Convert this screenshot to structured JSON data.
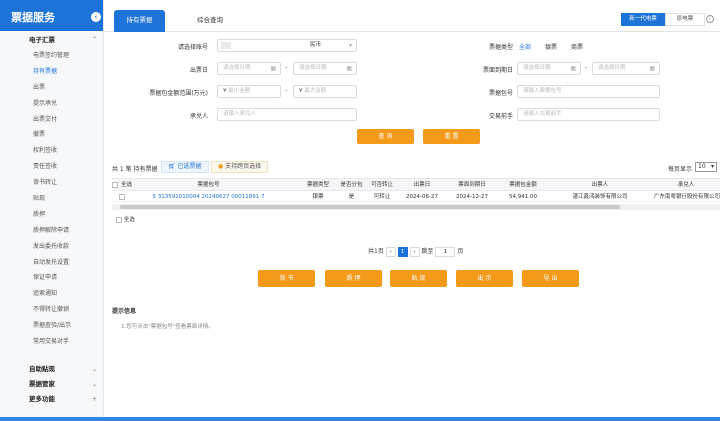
{
  "sidebar": {
    "title": "票据服务",
    "collapse_icon": "chevron-left",
    "group": "电子汇票",
    "items": [
      "电票签约管理",
      "持有票据",
      "出票",
      "提示承兑",
      "出票交付",
      "撤票",
      "权利签收",
      "责任签收",
      "背书转让",
      "贴现",
      "质押",
      "质押解除申请",
      "发出委托收款",
      "自动发托设置",
      "保证申请",
      "追索通知",
      "不得转让撤销",
      "票据查验/出示",
      "常用交易对手"
    ],
    "active_index": 1,
    "bottom_groups": [
      {
        "label": "自助贴现",
        "caret": "⌄"
      },
      {
        "label": "票据管家",
        "caret": "⌄"
      },
      {
        "label": "更多功能",
        "caret": "+"
      }
    ]
  },
  "tabs": [
    "持有票据",
    "综合查询"
  ],
  "active_tab": 0,
  "version_buttons": [
    "新一代电票",
    "原电票"
  ],
  "active_version": 0,
  "form": {
    "account_label": "请选择账号",
    "currency": "民币",
    "bill_type_label": "票据类型",
    "bill_type_options": [
      "全部",
      "银票",
      "商票"
    ],
    "issue_date_label": "出票日",
    "due_date_label": "票面到期日",
    "date_placeholder": "请选择日期",
    "amount_label": "票据包金额范围(万元)",
    "currency_symbol": "¥",
    "amount_min_placeholder": "最小金额",
    "amount_max_placeholder": "最大金额",
    "bill_no_label": "票据包号",
    "bill_no_placeholder": "请输入票据包号",
    "acceptor_label": "承兑人",
    "acceptor_placeholder": "请输入承兑人",
    "counterparty_label": "交易前手",
    "counterparty_placeholder": "请输入交易前手",
    "query_label": "查 询",
    "reset_label": "重 置"
  },
  "toolbar": {
    "count_text": "共 1 笔 持有票据",
    "selected_label": "已选票据",
    "cross_page_label": "支持跨页选择",
    "per_page_label": "每页显示",
    "per_page_value": "10"
  },
  "table": {
    "headers": [
      "全选",
      "票据包号",
      "票据类型",
      "是否分包",
      "可否转让",
      "出票日",
      "票面到期日",
      "票据包金额",
      "出票人",
      "承兑人"
    ],
    "rows": [
      [
        "",
        "5 313591010004 20240627 00011891 7",
        "银票",
        "是",
        "可转让",
        "2024-06-27",
        "2024-12-27",
        "54,941.00",
        "湛江鑫鸿装饰有限公司",
        "广东南粤银行股份有限公司"
      ]
    ],
    "footer_label": "全选"
  },
  "pager": {
    "total_pages": "共1页",
    "current": "1",
    "goto_label": "跳至",
    "goto_value": "1",
    "page_unit": "页"
  },
  "actions": [
    "背 书",
    "质 押",
    "贴 现",
    "出 示",
    "导 出"
  ],
  "tips": {
    "title": "提示信息",
    "text": "1.您可点击\"票据包号\"查看票面详情。"
  }
}
